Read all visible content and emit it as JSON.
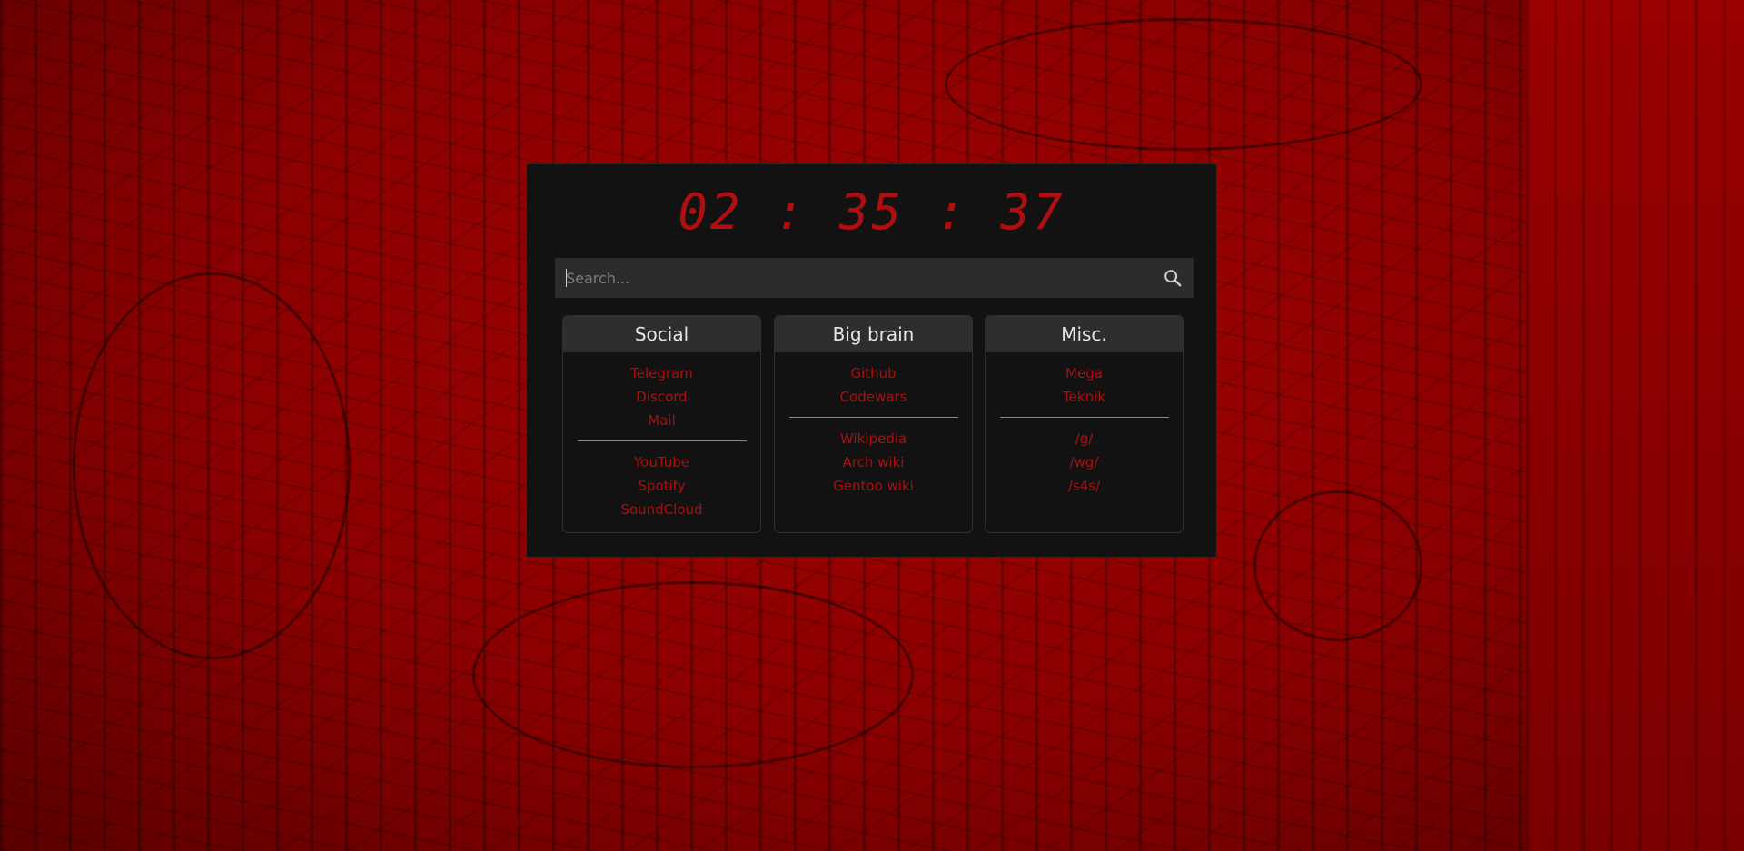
{
  "clock": {
    "time": "02 : 35 : 37"
  },
  "search": {
    "placeholder": "Search..."
  },
  "cards": [
    {
      "title": "Social",
      "groups": [
        [
          "Telegram",
          "Discord",
          "Mail"
        ],
        [
          "YouTube",
          "Spotify",
          "SoundCloud"
        ]
      ]
    },
    {
      "title": "Big brain",
      "groups": [
        [
          "Github",
          "Codewars"
        ],
        [
          "Wikipedia",
          "Arch wiki",
          "Gentoo wiki"
        ]
      ]
    },
    {
      "title": "Misc.",
      "groups": [
        [
          "Mega",
          "Teknik"
        ],
        [
          "/g/",
          "/wg/",
          "/s4s/"
        ]
      ]
    }
  ],
  "colors": {
    "accent": "#a81010",
    "panel": "#121212",
    "card_header": "#2e2e2e",
    "background": "#8c0000"
  },
  "icons": {
    "search": "search-icon"
  }
}
